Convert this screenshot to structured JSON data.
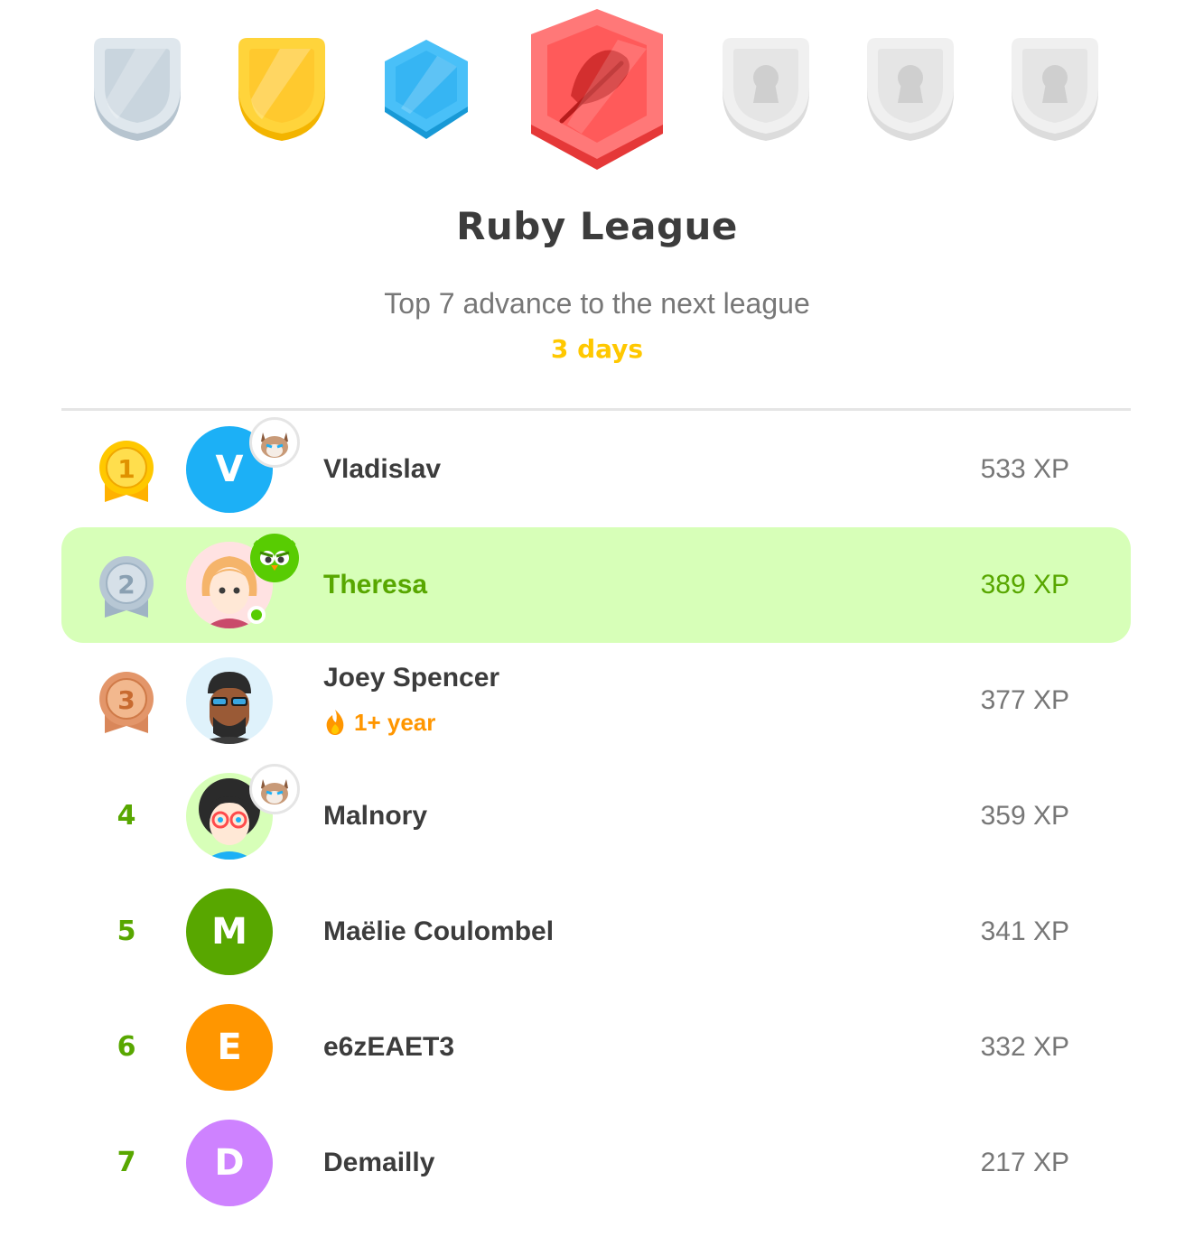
{
  "league": {
    "title": "Ruby League",
    "subtitle": "Top 7 advance to the next league",
    "time_left": "3 days"
  },
  "league_badges": [
    {
      "name": "silver",
      "color": "#cfd8df",
      "state": "completed"
    },
    {
      "name": "gold",
      "color": "#ffc800",
      "state": "completed"
    },
    {
      "name": "sapphire",
      "color": "#1cb0f6",
      "state": "completed"
    },
    {
      "name": "ruby",
      "color": "#ff4b4b",
      "state": "current",
      "icon": "feather-icon"
    },
    {
      "name": "locked-1",
      "color": "#e5e5e5",
      "state": "locked",
      "icon": "lock-icon"
    },
    {
      "name": "locked-2",
      "color": "#e5e5e5",
      "state": "locked",
      "icon": "lock-icon"
    },
    {
      "name": "locked-3",
      "color": "#e5e5e5",
      "state": "locked",
      "icon": "lock-icon"
    }
  ],
  "leaderboard": [
    {
      "rank": "1",
      "name": "Vladislav",
      "xp": "533 XP",
      "avatar_letter": "V",
      "avatar_color": "#1cb0f6",
      "badge": "cat-icon"
    },
    {
      "rank": "2",
      "name": "Theresa",
      "xp": "389 XP",
      "avatar": "girl-avatar",
      "badge": "owl-icon",
      "online": true,
      "current_user": true
    },
    {
      "rank": "3",
      "name": "Joey Spencer",
      "xp": "377 XP",
      "avatar": "man-with-sunglasses-avatar",
      "streak": "1+ year"
    },
    {
      "rank": "4",
      "name": "Malnory",
      "xp": "359 XP",
      "avatar": "woman-with-glasses-avatar",
      "badge": "cat-icon"
    },
    {
      "rank": "5",
      "name": "Maëlie Coulombel",
      "xp": "341 XP",
      "avatar_letter": "M",
      "avatar_color": "#58a700"
    },
    {
      "rank": "6",
      "name": "e6zEAET3",
      "xp": "332 XP",
      "avatar_letter": "E",
      "avatar_color": "#ff9600"
    },
    {
      "rank": "7",
      "name": "Demailly",
      "xp": "217 XP",
      "avatar_letter": "D",
      "avatar_color": "#ce82ff"
    }
  ]
}
